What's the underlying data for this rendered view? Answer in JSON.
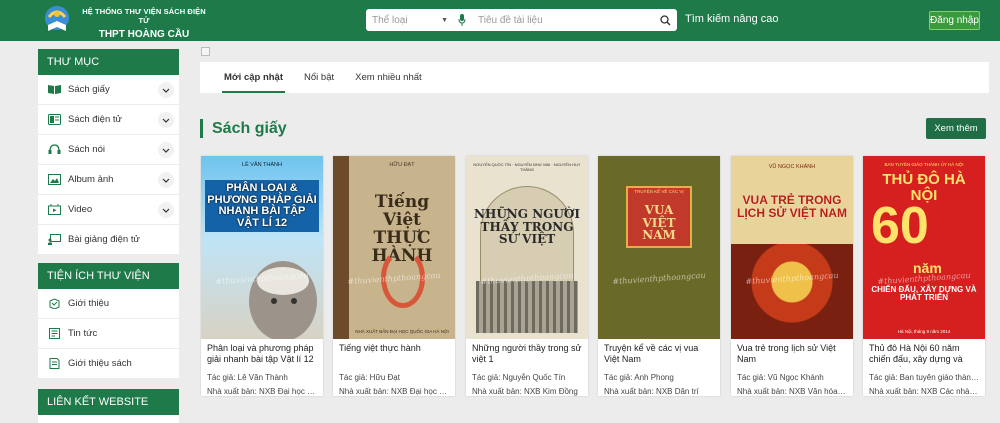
{
  "header": {
    "site_title_line1": "HỆ THỐNG THƯ VIỆN SÁCH ĐIỆN TỬ",
    "site_title_line2": "THPT HOÀNG CẦU",
    "category_placeholder": "Thể loại",
    "search_placeholder": "Tiêu đề tài liệu",
    "advanced_search": "Tìm kiếm nâng cao",
    "login": "Đăng nhập",
    "logo_icon": "library-logo-icon",
    "accent": "#1f7a4a"
  },
  "sidebar": {
    "directory": {
      "title": "THƯ MỤC",
      "items": [
        {
          "label": "Sách giấy",
          "icon": "book-open-icon",
          "expandable": true
        },
        {
          "label": "Sách điện tử",
          "icon": "ebook-icon",
          "expandable": true
        },
        {
          "label": "Sách nói",
          "icon": "audio-book-icon",
          "expandable": true
        },
        {
          "label": "Album ảnh",
          "icon": "photo-album-icon",
          "expandable": true
        },
        {
          "label": "Video",
          "icon": "video-icon",
          "expandable": true
        },
        {
          "label": "Bài giảng điện tử",
          "icon": "lecture-icon",
          "expandable": false
        }
      ]
    },
    "utilities": {
      "title": "TIỆN ÍCH THƯ VIỆN",
      "items": [
        {
          "label": "Giới thiệu",
          "icon": "intro-icon"
        },
        {
          "label": "Tin tức",
          "icon": "news-icon"
        },
        {
          "label": "Giới thiệu sách",
          "icon": "book-intro-icon"
        }
      ]
    },
    "links": {
      "title": "LIÊN KẾT WEBSITE"
    }
  },
  "main": {
    "tabs": [
      {
        "label": "Mới cập nhật",
        "active": true
      },
      {
        "label": "Nổi bật",
        "active": false
      },
      {
        "label": "Xem nhiều nhất",
        "active": false
      }
    ],
    "section_title": "Sách giấy",
    "more_button": "Xem thêm",
    "books": [
      {
        "title": "Phân loại và phương pháp giải nhanh bài tập Vật lí 12",
        "author": "Tác giả: Lê Văn Thành",
        "publisher": "Nhà xuất bản: NXB Đại học sư phạm",
        "cover": {
          "author": "LÊ VĂN THÀNH",
          "title": "PHÂN LOẠI & PHƯƠNG PHÁP GIẢI NHANH BÀI TẬP VẬT LÍ 12",
          "publisher": "",
          "watermark": "#thuvienthpthoangcau"
        }
      },
      {
        "title": "Tiếng việt thực hành",
        "author": "Tác giả: Hữu Đạt",
        "publisher": "Nhà xuất bản: NXB Đại học Quốc gia Hà Nội",
        "cover": {
          "author": "HỮU ĐẠT",
          "title": "Tiếng Việt THỰC HÀNH",
          "publisher": "NHÀ XUẤT BẢN ĐẠI HỌC QUỐC GIA HÀ NỘI",
          "watermark": "#thuvienthpthoangcau"
        }
      },
      {
        "title": "Những người thầy trong sử việt 1",
        "author": "Tác giả: Nguyễn Quốc Tín",
        "publisher": "Nhà xuất bản: NXB Kim Đồng",
        "cover": {
          "author": "NGUYỄN QUỐC TÍN · NGUYỄN NHƯ MAI · NGUYỄN HUY THẮNG",
          "title": "NHỮNG NGƯỜI THẦY TRONG SỬ VIỆT",
          "publisher": "",
          "watermark": "#thuvienthpthoangcau"
        }
      },
      {
        "title": "Truyện kể về các vị vua Việt Nam",
        "author": "Tác giả: Anh Phong",
        "publisher": "Nhà xuất bản: NXB Dân trí",
        "cover": {
          "author": "TRUYỆN KỂ VỀ CÁC VỊ",
          "title": "VUA VIỆT NAM",
          "publisher": "",
          "watermark": "#thuvienthpthoangcau"
        }
      },
      {
        "title": "Vua trẻ trong lịch sử Việt Nam",
        "author": "Tác giả: Vũ Ngọc Khánh",
        "publisher": "Nhà xuất bản: NXB Văn hóa - Thông tin",
        "cover": {
          "author": "VŨ NGỌC KHÁNH",
          "title": "VUA TRẺ TRONG LỊCH SỬ VIỆT NAM",
          "publisher": "",
          "watermark": "#thuvienthpthoangcau"
        }
      },
      {
        "title": "Thủ đô Hà Nội 60 năm chiến đấu, xây dựng và phát triển",
        "author": "Tác giả: Ban tuyên giáo thành ủy Hà Nội",
        "publisher": "Nhà xuất bản: NXB Các nhà xuất bản",
        "cover": {
          "author": "BAN TUYÊN GIÁO THÀNH ỦY HÀ NỘI",
          "title": "THỦ ĐÔ HÀ NỘI",
          "subtitle": "CHIẾN ĐẤU, XÂY DỰNG VÀ PHÁT TRIỂN",
          "number": "60",
          "unit": "năm",
          "publisher": "Hà Nội, tháng 9 năm 2014",
          "watermark": "#thuvienthpthoangcau"
        }
      }
    ]
  }
}
